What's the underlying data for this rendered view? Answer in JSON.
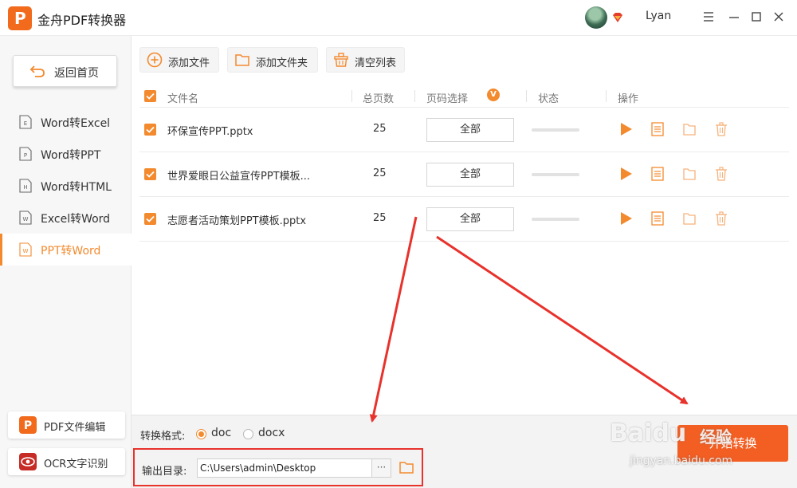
{
  "app": {
    "title": "金舟PDF转换器",
    "username": "Lyan"
  },
  "sidebar": {
    "back_label": "返回首页",
    "items": [
      {
        "label": "Word转Excel",
        "icon": "E"
      },
      {
        "label": "Word转PPT",
        "icon": "P"
      },
      {
        "label": "Word转HTML",
        "icon": "H"
      },
      {
        "label": "Excel转Word",
        "icon": "W"
      },
      {
        "label": "PPT转Word",
        "icon": "W",
        "active": true
      }
    ],
    "tools": [
      {
        "label": "PDF文件编辑"
      },
      {
        "label": "OCR文字识别"
      }
    ]
  },
  "toolbar": {
    "add_file": "添加文件",
    "add_folder": "添加文件夹",
    "clear_list": "清空列表"
  },
  "table": {
    "headers": {
      "name": "文件名",
      "pages": "总页数",
      "page_select": "页码选择",
      "page_select_badge": "V",
      "status": "状态",
      "ops": "操作"
    },
    "rows": [
      {
        "name": "环保宣传PPT.pptx",
        "pages": "25",
        "range": "全部",
        "progress": 0
      },
      {
        "name": "世界爱眼日公益宣传PPT模板...",
        "pages": "25",
        "range": "全部",
        "progress": 0
      },
      {
        "name": "志愿者活动策划PPT模板.pptx",
        "pages": "25",
        "range": "全部",
        "progress": 0
      }
    ]
  },
  "bottom": {
    "format_label": "转换格式:",
    "formats": [
      {
        "label": "doc",
        "checked": true
      },
      {
        "label": "docx",
        "checked": false
      }
    ],
    "output_label": "输出目录:",
    "output_path": "C:\\Users\\admin\\Desktop",
    "browse": "···",
    "start_label": "开始转换"
  },
  "watermark": {
    "logo": "Baidu",
    "cn": "经验",
    "url": "jingyan.baidu.com"
  },
  "colors": {
    "accent": "#f38a2e",
    "start": "#f35e22",
    "annotation": "#e8322c"
  }
}
